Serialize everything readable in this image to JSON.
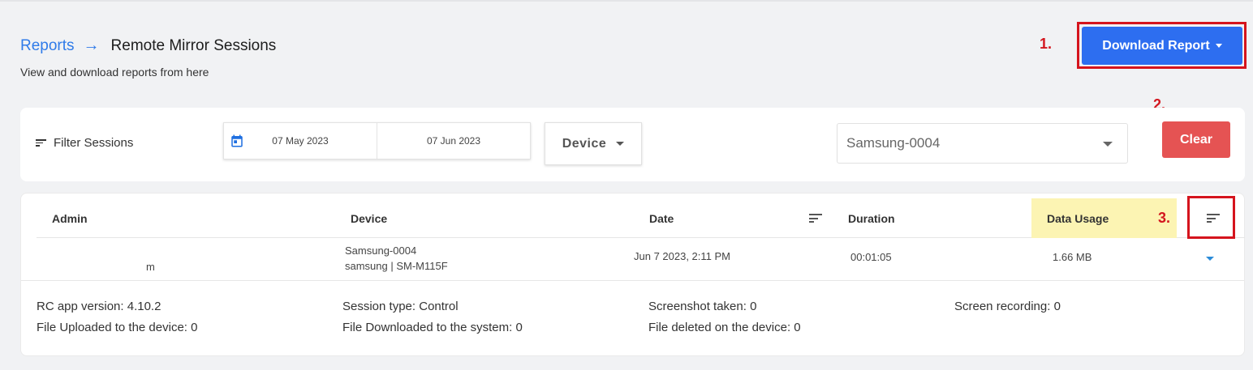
{
  "header": {
    "breadcrumb_root": "Reports",
    "breadcrumb_current": "Remote Mirror Sessions",
    "subtitle": "View and download reports from here",
    "download_label": "Download Report"
  },
  "annotations": [
    "1.",
    "2.",
    "3."
  ],
  "filters": {
    "label": "Filter Sessions",
    "date_from": "07 May 2023",
    "date_to": "07 Jun 2023",
    "device_dropdown_label": "Device",
    "selected_device": "Samsung-0004",
    "clear_label": "Clear"
  },
  "table": {
    "columns": [
      "Admin",
      "Device",
      "Date",
      "Duration",
      "Data Usage"
    ],
    "rows": [
      {
        "admin_suffix": "m",
        "device_name": "Samsung-0004",
        "device_model": "samsung | SM-M115F",
        "date": "Jun 7 2023, 2:11 PM",
        "duration": "00:01:05",
        "data_usage": "1.66 MB"
      }
    ],
    "details": {
      "rc_app_version_label": "RC app version:",
      "rc_app_version": "4.10.2",
      "session_type_label": "Session type:",
      "session_type": "Control",
      "screenshot_label": "Screenshot taken:",
      "screenshot": "0",
      "recording_label": "Screen recording:",
      "recording": "0",
      "uploaded_label": "File Uploaded to the device:",
      "uploaded": "0",
      "downloaded_label": "File Downloaded to the system:",
      "downloaded": "0",
      "deleted_label": "File deleted on the device:",
      "deleted": "0"
    }
  },
  "colors": {
    "accent": "#2d6ef0",
    "danger": "#e55353",
    "highlight": "#fcf4b3",
    "annotation_red": "#d5141d"
  }
}
